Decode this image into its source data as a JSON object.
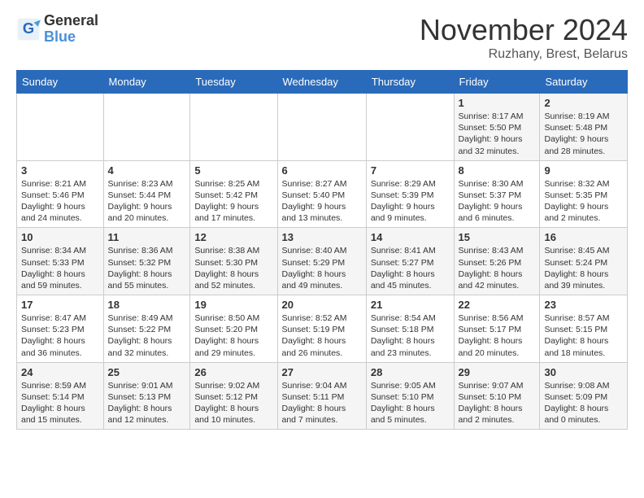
{
  "header": {
    "logo_general": "General",
    "logo_blue": "Blue",
    "month_title": "November 2024",
    "location": "Ruzhany, Brest, Belarus"
  },
  "days_of_week": [
    "Sunday",
    "Monday",
    "Tuesday",
    "Wednesday",
    "Thursday",
    "Friday",
    "Saturday"
  ],
  "weeks": [
    [
      {
        "day": "",
        "info": ""
      },
      {
        "day": "",
        "info": ""
      },
      {
        "day": "",
        "info": ""
      },
      {
        "day": "",
        "info": ""
      },
      {
        "day": "",
        "info": ""
      },
      {
        "day": "1",
        "info": "Sunrise: 8:17 AM\nSunset: 5:50 PM\nDaylight: 9 hours and 32 minutes."
      },
      {
        "day": "2",
        "info": "Sunrise: 8:19 AM\nSunset: 5:48 PM\nDaylight: 9 hours and 28 minutes."
      }
    ],
    [
      {
        "day": "3",
        "info": "Sunrise: 8:21 AM\nSunset: 5:46 PM\nDaylight: 9 hours and 24 minutes."
      },
      {
        "day": "4",
        "info": "Sunrise: 8:23 AM\nSunset: 5:44 PM\nDaylight: 9 hours and 20 minutes."
      },
      {
        "day": "5",
        "info": "Sunrise: 8:25 AM\nSunset: 5:42 PM\nDaylight: 9 hours and 17 minutes."
      },
      {
        "day": "6",
        "info": "Sunrise: 8:27 AM\nSunset: 5:40 PM\nDaylight: 9 hours and 13 minutes."
      },
      {
        "day": "7",
        "info": "Sunrise: 8:29 AM\nSunset: 5:39 PM\nDaylight: 9 hours and 9 minutes."
      },
      {
        "day": "8",
        "info": "Sunrise: 8:30 AM\nSunset: 5:37 PM\nDaylight: 9 hours and 6 minutes."
      },
      {
        "day": "9",
        "info": "Sunrise: 8:32 AM\nSunset: 5:35 PM\nDaylight: 9 hours and 2 minutes."
      }
    ],
    [
      {
        "day": "10",
        "info": "Sunrise: 8:34 AM\nSunset: 5:33 PM\nDaylight: 8 hours and 59 minutes."
      },
      {
        "day": "11",
        "info": "Sunrise: 8:36 AM\nSunset: 5:32 PM\nDaylight: 8 hours and 55 minutes."
      },
      {
        "day": "12",
        "info": "Sunrise: 8:38 AM\nSunset: 5:30 PM\nDaylight: 8 hours and 52 minutes."
      },
      {
        "day": "13",
        "info": "Sunrise: 8:40 AM\nSunset: 5:29 PM\nDaylight: 8 hours and 49 minutes."
      },
      {
        "day": "14",
        "info": "Sunrise: 8:41 AM\nSunset: 5:27 PM\nDaylight: 8 hours and 45 minutes."
      },
      {
        "day": "15",
        "info": "Sunrise: 8:43 AM\nSunset: 5:26 PM\nDaylight: 8 hours and 42 minutes."
      },
      {
        "day": "16",
        "info": "Sunrise: 8:45 AM\nSunset: 5:24 PM\nDaylight: 8 hours and 39 minutes."
      }
    ],
    [
      {
        "day": "17",
        "info": "Sunrise: 8:47 AM\nSunset: 5:23 PM\nDaylight: 8 hours and 36 minutes."
      },
      {
        "day": "18",
        "info": "Sunrise: 8:49 AM\nSunset: 5:22 PM\nDaylight: 8 hours and 32 minutes."
      },
      {
        "day": "19",
        "info": "Sunrise: 8:50 AM\nSunset: 5:20 PM\nDaylight: 8 hours and 29 minutes."
      },
      {
        "day": "20",
        "info": "Sunrise: 8:52 AM\nSunset: 5:19 PM\nDaylight: 8 hours and 26 minutes."
      },
      {
        "day": "21",
        "info": "Sunrise: 8:54 AM\nSunset: 5:18 PM\nDaylight: 8 hours and 23 minutes."
      },
      {
        "day": "22",
        "info": "Sunrise: 8:56 AM\nSunset: 5:17 PM\nDaylight: 8 hours and 20 minutes."
      },
      {
        "day": "23",
        "info": "Sunrise: 8:57 AM\nSunset: 5:15 PM\nDaylight: 8 hours and 18 minutes."
      }
    ],
    [
      {
        "day": "24",
        "info": "Sunrise: 8:59 AM\nSunset: 5:14 PM\nDaylight: 8 hours and 15 minutes."
      },
      {
        "day": "25",
        "info": "Sunrise: 9:01 AM\nSunset: 5:13 PM\nDaylight: 8 hours and 12 minutes."
      },
      {
        "day": "26",
        "info": "Sunrise: 9:02 AM\nSunset: 5:12 PM\nDaylight: 8 hours and 10 minutes."
      },
      {
        "day": "27",
        "info": "Sunrise: 9:04 AM\nSunset: 5:11 PM\nDaylight: 8 hours and 7 minutes."
      },
      {
        "day": "28",
        "info": "Sunrise: 9:05 AM\nSunset: 5:10 PM\nDaylight: 8 hours and 5 minutes."
      },
      {
        "day": "29",
        "info": "Sunrise: 9:07 AM\nSunset: 5:10 PM\nDaylight: 8 hours and 2 minutes."
      },
      {
        "day": "30",
        "info": "Sunrise: 9:08 AM\nSunset: 5:09 PM\nDaylight: 8 hours and 0 minutes."
      }
    ]
  ]
}
